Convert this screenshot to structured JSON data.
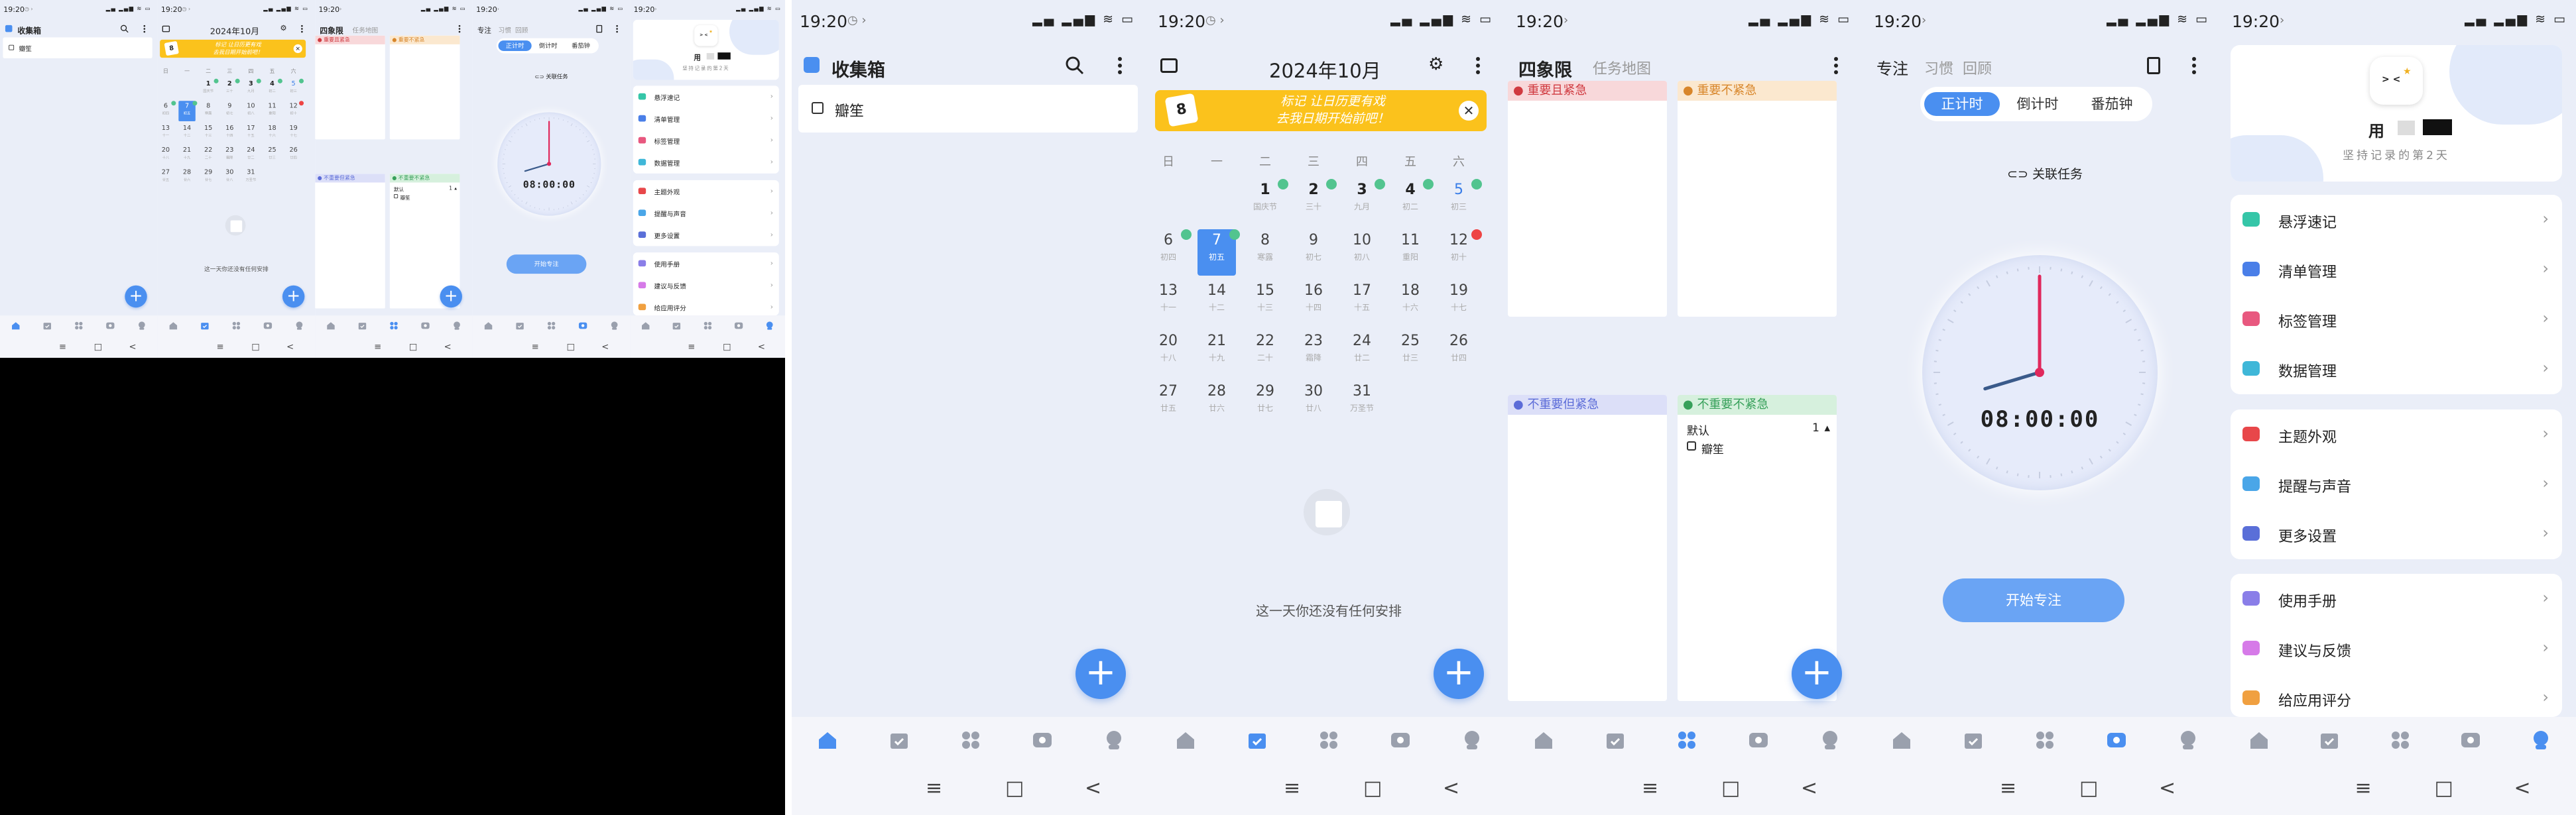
{
  "status": {
    "time": "19:20",
    "battery": "83"
  },
  "tabs": [
    "home-icon",
    "calendar-icon",
    "grid-icon",
    "focus-icon",
    "profile-icon"
  ],
  "nav": [
    "≡",
    "□",
    "<"
  ],
  "inbox": {
    "title": "收集箱",
    "tasks": [
      "瓣笙"
    ]
  },
  "calendar": {
    "title": "2024年10月",
    "banner_line1": "标记 让日历更有戏",
    "banner_line2": "去我日期开始前吧！",
    "weekdays": [
      "日",
      "一",
      "二",
      "三",
      "四",
      "五",
      "六"
    ],
    "days": [
      {
        "d": "1",
        "l": "国庆节"
      },
      {
        "d": "2",
        "l": "三十"
      },
      {
        "d": "3",
        "l": "九月"
      },
      {
        "d": "4",
        "l": "初二"
      },
      {
        "d": "5",
        "l": "初三"
      },
      {
        "d": "6",
        "l": "初四"
      },
      {
        "d": "7",
        "l": "初五"
      },
      {
        "d": "8",
        "l": "寒露"
      },
      {
        "d": "9",
        "l": "初七"
      },
      {
        "d": "10",
        "l": "初八"
      },
      {
        "d": "11",
        "l": "重阳"
      },
      {
        "d": "12",
        "l": "初十"
      },
      {
        "d": "13",
        "l": "十一"
      },
      {
        "d": "14",
        "l": "十二"
      },
      {
        "d": "15",
        "l": "十三"
      },
      {
        "d": "16",
        "l": "十四"
      },
      {
        "d": "17",
        "l": "十五"
      },
      {
        "d": "18",
        "l": "十六"
      },
      {
        "d": "19",
        "l": "十七"
      },
      {
        "d": "20",
        "l": "十八"
      },
      {
        "d": "21",
        "l": "十九"
      },
      {
        "d": "22",
        "l": "二十"
      },
      {
        "d": "23",
        "l": "霜降"
      },
      {
        "d": "24",
        "l": "廿二"
      },
      {
        "d": "25",
        "l": "廿三"
      },
      {
        "d": "26",
        "l": "廿四"
      },
      {
        "d": "27",
        "l": "廿五"
      },
      {
        "d": "28",
        "l": "廿六"
      },
      {
        "d": "29",
        "l": "廿七"
      },
      {
        "d": "30",
        "l": "廿八"
      },
      {
        "d": "31",
        "l": "万圣节"
      }
    ],
    "empty_text": "这一天你还没有任何安排"
  },
  "quadrant": {
    "title": "四象限",
    "tab2": "任务地图",
    "q1": "重要且紧急",
    "q2": "重要不紧急",
    "q3": "不重要但紧急",
    "q4": "不重要不紧急",
    "q4_group": "默认",
    "q4_count": "1",
    "q4_task": "瓣笙"
  },
  "focus": {
    "title": "专注",
    "tab_habit": "习惯",
    "tab_review": "回顾",
    "seg": [
      "正计时",
      "倒计时",
      "番茄钟"
    ],
    "link_task": "关联任务",
    "time": "08:00:00",
    "start": "开始专注"
  },
  "profile": {
    "name": "用",
    "subtitle": "坚持记录的第2天",
    "group1": [
      "悬浮速记",
      "清单管理",
      "标签管理",
      "数据管理"
    ],
    "group2": [
      "主题外观",
      "提醒与声音",
      "更多设置"
    ],
    "group3": [
      "使用手册",
      "建议与反馈",
      "给应用评分"
    ],
    "colors1": [
      "#35c6a8",
      "#4a7fe8",
      "#e8587f",
      "#3fb7d8"
    ],
    "colors2": [
      "#e8474a",
      "#4aa6e8",
      "#5a6fd8"
    ],
    "colors3": [
      "#8a7ee8",
      "#d67ae8",
      "#f0a040"
    ]
  },
  "colors": {
    "accent": "#4a8ff0",
    "banner": "#fbc21c",
    "q1": "#f8d8da",
    "q2": "#fbe8cf",
    "q3": "#dcdff8",
    "q4": "#d6f0dd"
  }
}
